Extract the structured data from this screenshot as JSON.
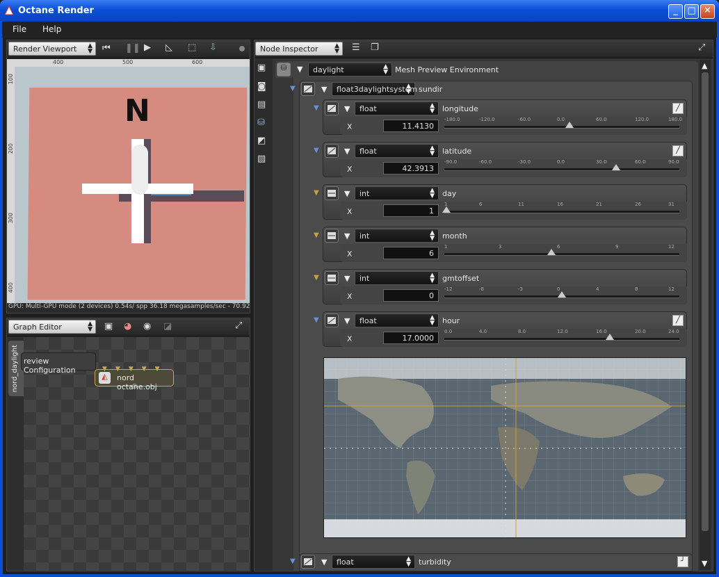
{
  "window": {
    "title": "Octane Render",
    "minimize": "_",
    "maximize": "□",
    "close": "✕"
  },
  "menu": {
    "file": "File",
    "help": "Help"
  },
  "viewport": {
    "selector": "Render Viewport",
    "ruler_top": [
      "400",
      "500",
      "600"
    ],
    "ruler_left": [
      "100",
      "200",
      "300",
      "400"
    ],
    "status": "GPU: Multi-GPU mode (2 devices) 0.54s/ spp  36.18 megasamples/sec - 70.92 FPS",
    "scene_letter": "N"
  },
  "graph": {
    "selector": "Graph Editor",
    "tab": "nord_daylight",
    "preview_node": "review Configuration",
    "mesh_node": "nord octane.obj"
  },
  "inspector": {
    "selector": "Node Inspector",
    "root_type": "daylight",
    "root_name": "Mesh Preview Environment",
    "child_type": "float3daylightsystem",
    "child_name": "sundir",
    "params": [
      {
        "type": "float",
        "name": "longitude",
        "axis": "X",
        "value": "11.4130",
        "ticks": [
          "-180.0",
          "-120.0",
          "-60.0",
          "0.0",
          "60.0",
          "120.0",
          "180.0"
        ],
        "position": 0.532,
        "editable": true
      },
      {
        "type": "float",
        "name": "latitude",
        "axis": "X",
        "value": "42.3913",
        "ticks": [
          "-90.0",
          "-60.0",
          "-30.0",
          "0.0",
          "30.0",
          "60.0",
          "90.0"
        ],
        "position": 0.735,
        "editable": true
      },
      {
        "type": "int",
        "name": "day",
        "axis": "X",
        "value": "1",
        "ticks": [
          "1",
          "6",
          "11",
          "16",
          "21",
          "26",
          "31"
        ],
        "position": 0.0,
        "editable": false
      },
      {
        "type": "int",
        "name": "month",
        "axis": "X",
        "value": "6",
        "ticks": [
          "1",
          "3",
          "6",
          "9",
          "12"
        ],
        "position": 0.455,
        "editable": false
      },
      {
        "type": "int",
        "name": "gmtoffset",
        "axis": "X",
        "value": "0",
        "ticks": [
          "-12",
          "-8",
          "-3",
          "0",
          "4",
          "8",
          "12"
        ],
        "position": 0.5,
        "editable": false
      },
      {
        "type": "float",
        "name": "hour",
        "axis": "X",
        "value": "17.0000",
        "ticks": [
          "0.0",
          "4.0",
          "8.0",
          "12.0",
          "16.0",
          "20.0",
          "24.0"
        ],
        "position": 0.708,
        "editable": true
      }
    ],
    "last_type": "float",
    "last_name": "turbidity"
  }
}
